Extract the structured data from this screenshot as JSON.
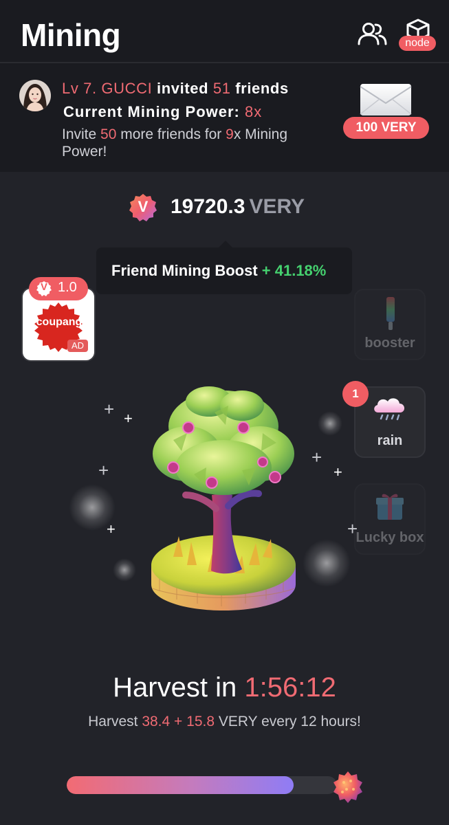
{
  "header": {
    "title": "Mining",
    "friends_icon": "friends-icon",
    "node_icon": "cube-icon",
    "node_badge": "node"
  },
  "invite": {
    "level": "Lv 7.",
    "name": "GUCCI",
    "invited_text": "invited",
    "friend_count": "51",
    "friends_word": "friends",
    "power_label": "Current Mining Power:",
    "power_value": "8x",
    "invite_prefix": "Invite",
    "invite_more": "50",
    "invite_mid": "more friends for",
    "invite_target": "9",
    "invite_suffix": "x Mining Power!",
    "reward": "100 VERY"
  },
  "balance": {
    "amount": "19720.3",
    "unit": "VERY",
    "coin_letter": "V"
  },
  "boost": {
    "label": "Friend Mining Boost",
    "value": "+ 41.18%"
  },
  "ad": {
    "reward": "1.0",
    "brand": "coupang",
    "tag": "AD",
    "coin_letter": "V"
  },
  "side_buttons": {
    "booster": "booster",
    "rain": "rain",
    "rain_count": "1",
    "lucky_box": "Lucky box"
  },
  "harvest": {
    "label": "Harvest in",
    "timer": "1:56:12",
    "sub_prefix": "Harvest",
    "base": "38.4",
    "plus": "+",
    "bonus": "15.8",
    "sub_suffix": "VERY every 12 hours!",
    "progress": 0.84
  },
  "colors": {
    "accent": "#f05d63",
    "green": "#45d16f",
    "background": "#222329"
  }
}
